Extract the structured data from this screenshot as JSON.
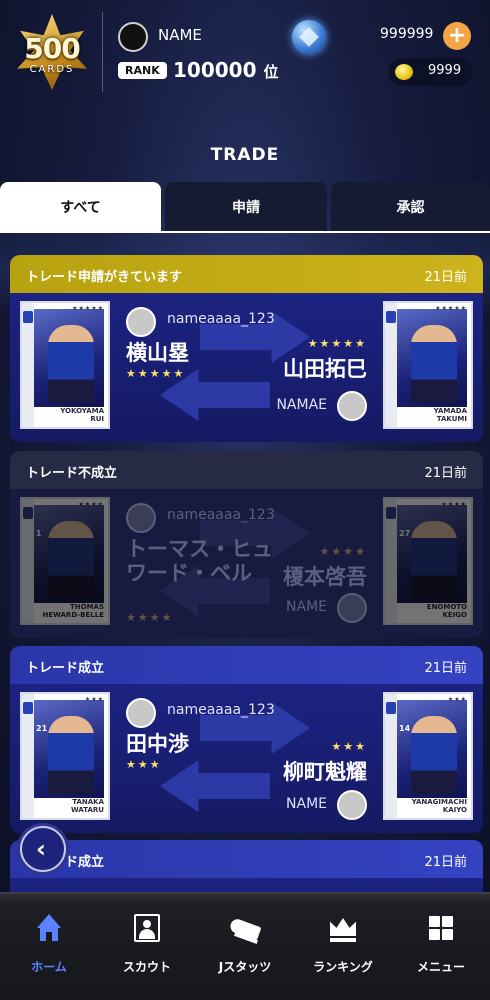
{
  "header": {
    "logo_number": "500",
    "logo_text": "CARDS",
    "user_name": "NAME",
    "coins": "999999",
    "plus_label": "+",
    "rank_label": "RANK",
    "rank_value": "100000",
    "rank_unit": "位",
    "gold": "9999"
  },
  "page_title": "TRADE",
  "tabs": [
    "すべて",
    "申請",
    "承認"
  ],
  "trades": [
    {
      "status": "トレード申請がきています",
      "time": "21日前",
      "left_user": "nameaaaa_123",
      "left_player": "横山塁",
      "left_stars": "★★★★★",
      "left_card_name": "YOKOYAMA\nRUI",
      "right_player": "山田拓巳",
      "right_stars": "★★★★★",
      "right_user": "NAMAE",
      "right_card_name": "YAMADA\nTAKUMI"
    },
    {
      "status": "トレード不成立",
      "time": "21日前",
      "left_user": "nameaaaa_123",
      "left_player": "トーマス・ヒュワード・ベル",
      "left_stars": "★★★★",
      "left_card_name": "THOMAS\nHEWARD-BELLE",
      "left_card_number": "1",
      "right_player": "榎本啓吾",
      "right_stars": "★★★★",
      "right_user": "NAME",
      "right_card_name": "ENOMOTO\nKEIGO",
      "right_card_number": "27"
    },
    {
      "status": "トレード成立",
      "time": "21日前",
      "left_user": "nameaaaa_123",
      "left_player": "田中渉",
      "left_stars": "★★★",
      "left_card_name": "TANAKA\nWATARU",
      "left_card_number": "21",
      "right_player": "柳町魁耀",
      "right_stars": "★★★",
      "right_user": "NAME",
      "right_card_name": "YANAGIMACHI\nKAIYO",
      "right_card_number": "14"
    },
    {
      "status": "トレード成立",
      "time": "21日前"
    }
  ],
  "back_label": "‹",
  "nav": [
    "ホーム",
    "スカウト",
    "Jスタッツ",
    "ランキング",
    "メニュー"
  ],
  "colors": {
    "accent": "#5b82ff",
    "status_request": "#cdb31d",
    "status_failed": "#262a45",
    "status_success": "#3443c2",
    "stars": "#ffe16a"
  }
}
